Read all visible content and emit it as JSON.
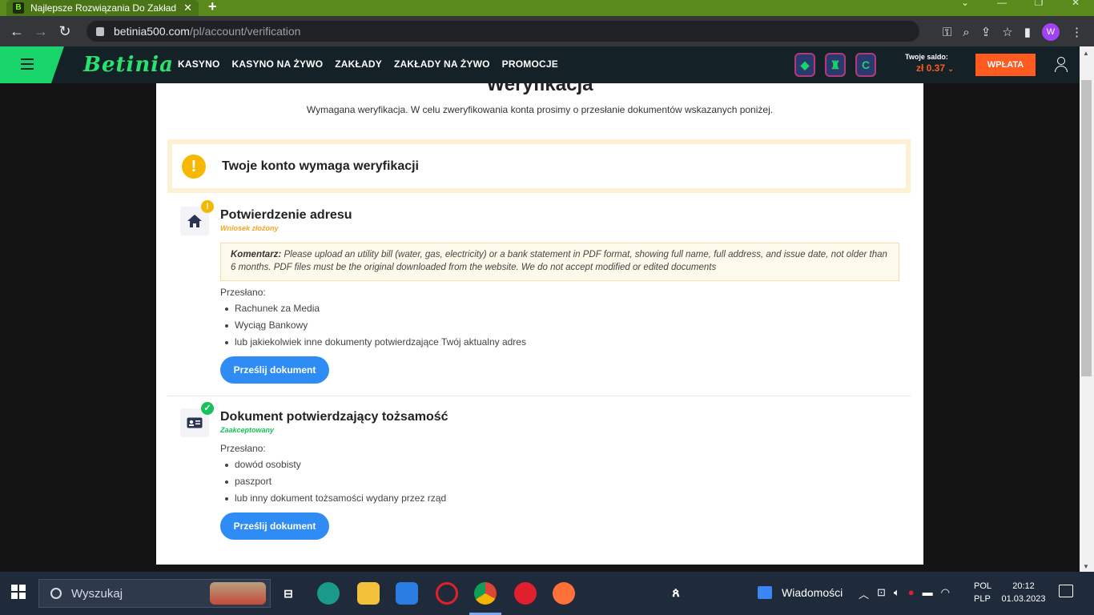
{
  "browser": {
    "tab_title": "Najlepsze Rozwiązania Do Zakład",
    "tab_favicon": "B",
    "tab_close": "✕",
    "new_tab": "+",
    "url_host": "betinia500.com",
    "url_path": "/pl/account/verification",
    "profile_initial": "W"
  },
  "site": {
    "logo": "Betinia",
    "nav": [
      "KASYNO",
      "KASYNO NA ŻYWO",
      "ZAKŁADY",
      "ZAKŁADY NA ŻYWO",
      "PROMOCJE"
    ],
    "balance_label": "Twoje saldo:",
    "balance_amount": "zł 0.37",
    "deposit_label": "WPŁATA"
  },
  "page": {
    "title": "Weryfikacja",
    "subtitle": "Wymagana weryfikacja. W celu zweryfikowania konta prosimy o przesłanie dokumentów wskazanych poniżej.",
    "alert": "Twoje konto wymaga weryfikacji",
    "address": {
      "title": "Potwierdzenie adresu",
      "status": "Wniosek złożony",
      "status_color": "#f5a623",
      "comment_label": "Komentarz:",
      "comment_text": "Please upload an utility bill (water, gas, electricity) or a bank statement in PDF format, showing full name, full address, and issue date, not older than 6 months. PDF files must be the original downloaded from the website. We do not accept modified or edited documents",
      "sent_label": "Przesłano:",
      "documents": [
        "Rachunek za Media",
        "Wyciąg Bankowy",
        "lub jakiekolwiek inne dokumenty potwierdzające Twój aktualny adres"
      ],
      "button": "Prześlij dokument"
    },
    "identity": {
      "title": "Dokument potwierdzający tożsamość",
      "status": "Zaakceptowany",
      "status_color": "#19c15a",
      "sent_label": "Przesłano:",
      "documents": [
        "dowód osobisty",
        "paszport",
        "lub inny dokument tożsamości wydany przez rząd"
      ],
      "button": "Prześlij dokument"
    }
  },
  "taskbar": {
    "search_placeholder": "Wyszukaj",
    "news": "Wiadomości",
    "lang_top": "POL",
    "lang_bottom": "PLP",
    "time": "20:12",
    "date": "01.03.2023"
  },
  "colors": {
    "brand_green": "#19d36b",
    "accent_orange": "#ff5a1f",
    "button_blue": "#2f8cf5"
  }
}
